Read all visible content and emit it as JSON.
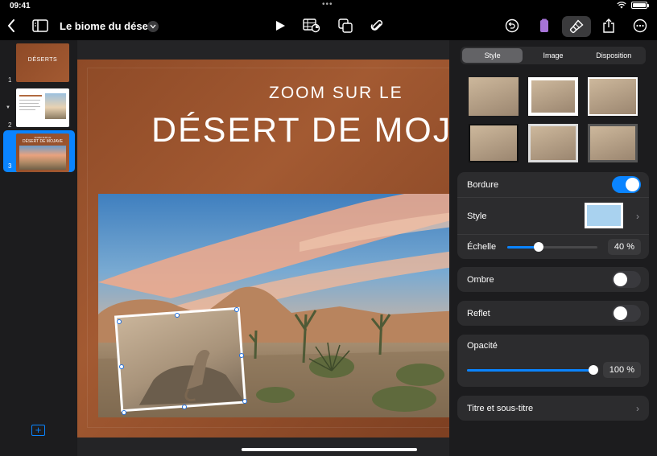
{
  "status": {
    "time": "09:41",
    "battery_level": 1.0
  },
  "toolbar": {
    "doc_title": "Le biome du désert",
    "icons": [
      "back-chevron-icon",
      "sidebar-icon",
      "chevron-down-icon",
      "play-icon",
      "table-chart-icon",
      "shapes-icon",
      "paperclip-icon",
      "undo-icon",
      "phone-icon",
      "paintbrush-icon",
      "share-icon",
      "more-icon"
    ]
  },
  "navigator": {
    "slides": [
      {
        "number": "1",
        "thumb_title": "DÉSERTS"
      },
      {
        "number": "2",
        "thumb_title": ""
      },
      {
        "number": "3",
        "thumb_title": "DÉSERT DE MOJAVE",
        "thumb_sub": "ZOOM SUR LE"
      }
    ],
    "selected": 3
  },
  "slide": {
    "subtitle": "ZOOM SUR LE",
    "title": "DÉSERT DE MOJAVE"
  },
  "inspector": {
    "tabs": [
      "Style",
      "Image",
      "Disposition"
    ],
    "active_tab": "Style",
    "border": {
      "label": "Bordure",
      "on": true
    },
    "style": {
      "label": "Style"
    },
    "scale": {
      "label": "Échelle",
      "value": "40 %",
      "level": 0.4
    },
    "shadow": {
      "label": "Ombre",
      "on": false
    },
    "reflection": {
      "label": "Reflet",
      "on": false
    },
    "opacity": {
      "label": "Opacité",
      "value": "100 %",
      "level": 1.0
    },
    "title_subtitle": {
      "label": "Titre et sous-titre"
    }
  },
  "colors": {
    "accent": "#0a84ff",
    "panel": "#2c2c2e",
    "slide_bg": "#9a532d"
  }
}
